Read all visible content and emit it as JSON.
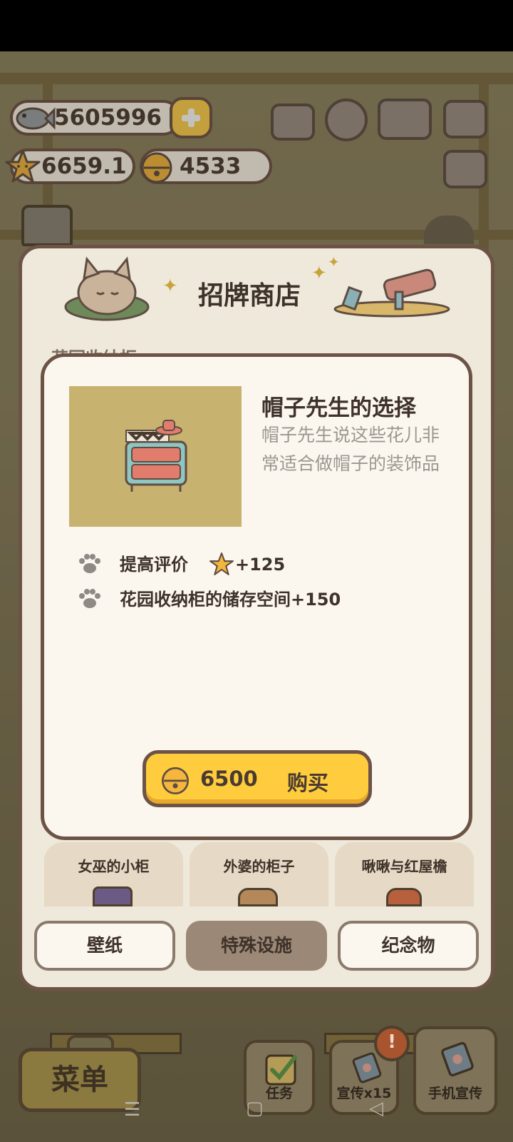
{
  "hud": {
    "fish_count": "5605996",
    "star_rating": "6659.1",
    "bell_count": "4533"
  },
  "shop": {
    "title": "招牌商店",
    "behind_label": "花园收纳柜"
  },
  "item": {
    "name": "帽子先生的选择",
    "description": "帽子先生说这些花儿非常适合做帽子的装饰品",
    "effects": [
      {
        "text": "提高评价",
        "bonus": "+125"
      },
      {
        "text": "花园收纳柜的储存空间+150"
      }
    ],
    "price": "6500",
    "buy_label": "购买"
  },
  "products": [
    {
      "name": "女巫的小柜"
    },
    {
      "name": "外婆的柜子"
    },
    {
      "name": "啾啾与红屋檐"
    }
  ],
  "categories": [
    {
      "label": "壁纸",
      "active": false
    },
    {
      "label": "特殊设施",
      "active": true
    },
    {
      "label": "纪念物",
      "active": false
    }
  ],
  "bottom_bar": {
    "menu_label": "菜单",
    "task_label": "任务",
    "promo_label": "宣传x15",
    "phone_promo_label": "手机宣传",
    "badge": "!"
  },
  "colors": {
    "panel_border": "#6c5345",
    "buy_button": "#ffcc3e",
    "item_bg": "#c8b26f"
  }
}
